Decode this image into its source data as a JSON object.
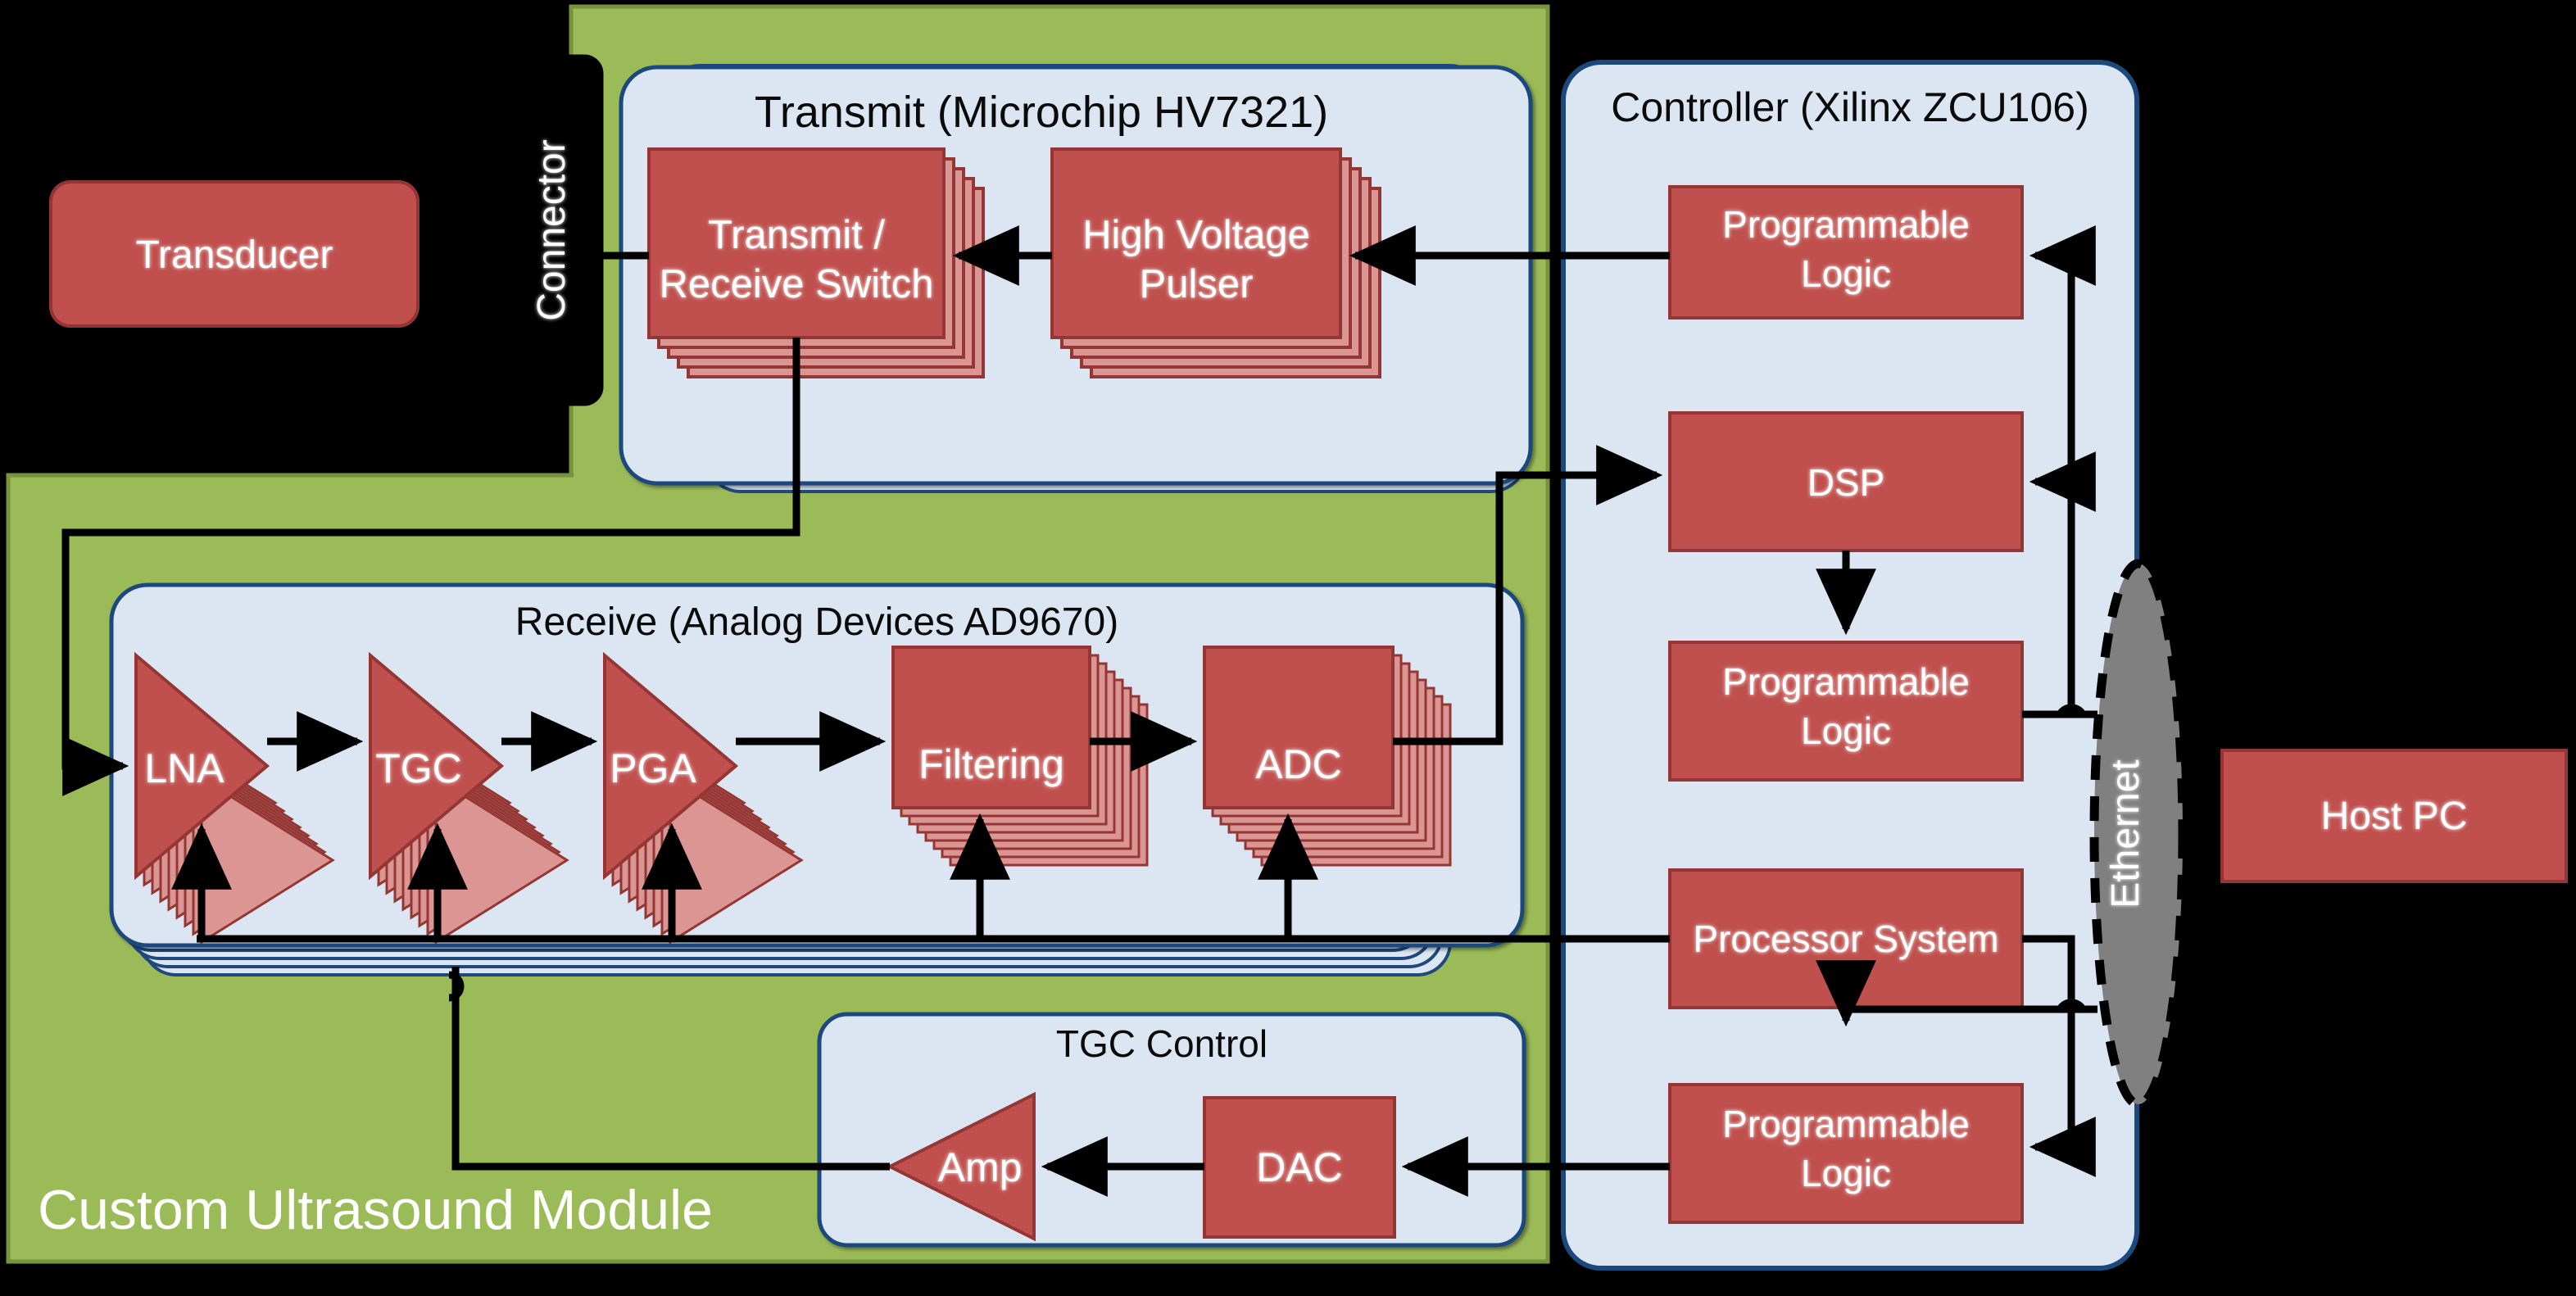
{
  "diagram": {
    "title": "Custom Ultrasound Module block diagram",
    "colors": {
      "module_green": "#9BBB59",
      "module_green_border": "#77933C",
      "panel_blue_fill": "#DCE6F2",
      "panel_blue_border": "#1F497D",
      "block_red_fill": "#C0504D",
      "block_red_border": "#943634",
      "block_red_ghost": "#DB9694",
      "connector_black": "#000000",
      "ethernet_gray": "#808080",
      "wire_black": "#000000",
      "background": "#000000"
    }
  },
  "module": {
    "label": "Custom Ultrasound Module"
  },
  "transducer": {
    "label": "Transducer"
  },
  "connector": {
    "label": "Connector"
  },
  "transmit_panel": {
    "title": "Transmit (Microchip HV7321)",
    "blocks": [
      {
        "id": "tr-switch",
        "label": "Transmit /\nReceive Switch",
        "line1": "Transmit /",
        "line2": "Receive Switch"
      },
      {
        "id": "hv-pulser",
        "label": "High Voltage\nPulser",
        "line1": "High Voltage",
        "line2": "Pulser"
      }
    ]
  },
  "receive_panel": {
    "title": "Receive (Analog Devices AD9670)",
    "blocks": [
      {
        "id": "lna",
        "label": "LNA",
        "shape": "triangle"
      },
      {
        "id": "tgc",
        "label": "TGC",
        "shape": "triangle"
      },
      {
        "id": "pga",
        "label": "PGA",
        "shape": "triangle"
      },
      {
        "id": "filtering",
        "label": "Filtering",
        "shape": "rect"
      },
      {
        "id": "adc",
        "label": "ADC",
        "shape": "rect"
      }
    ]
  },
  "tgc_control_panel": {
    "title": "TGC Control",
    "blocks": [
      {
        "id": "amp",
        "label": "Amp",
        "shape": "triangle-left"
      },
      {
        "id": "dac",
        "label": "DAC",
        "shape": "rect"
      }
    ]
  },
  "controller_panel": {
    "title": "Controller (Xilinx  ZCU106)",
    "blocks": [
      {
        "id": "pl-top",
        "line1": "Programmable",
        "line2": "Logic"
      },
      {
        "id": "dsp",
        "line1": "DSP",
        "line2": ""
      },
      {
        "id": "pl-mid",
        "line1": "Programmable",
        "line2": "Logic"
      },
      {
        "id": "ps",
        "line1": "Processor System",
        "line2": ""
      },
      {
        "id": "pl-bottom",
        "line1": "Programmable",
        "line2": "Logic"
      }
    ]
  },
  "ethernet": {
    "label": "Ethernet"
  },
  "host_pc": {
    "label": "Host PC"
  }
}
